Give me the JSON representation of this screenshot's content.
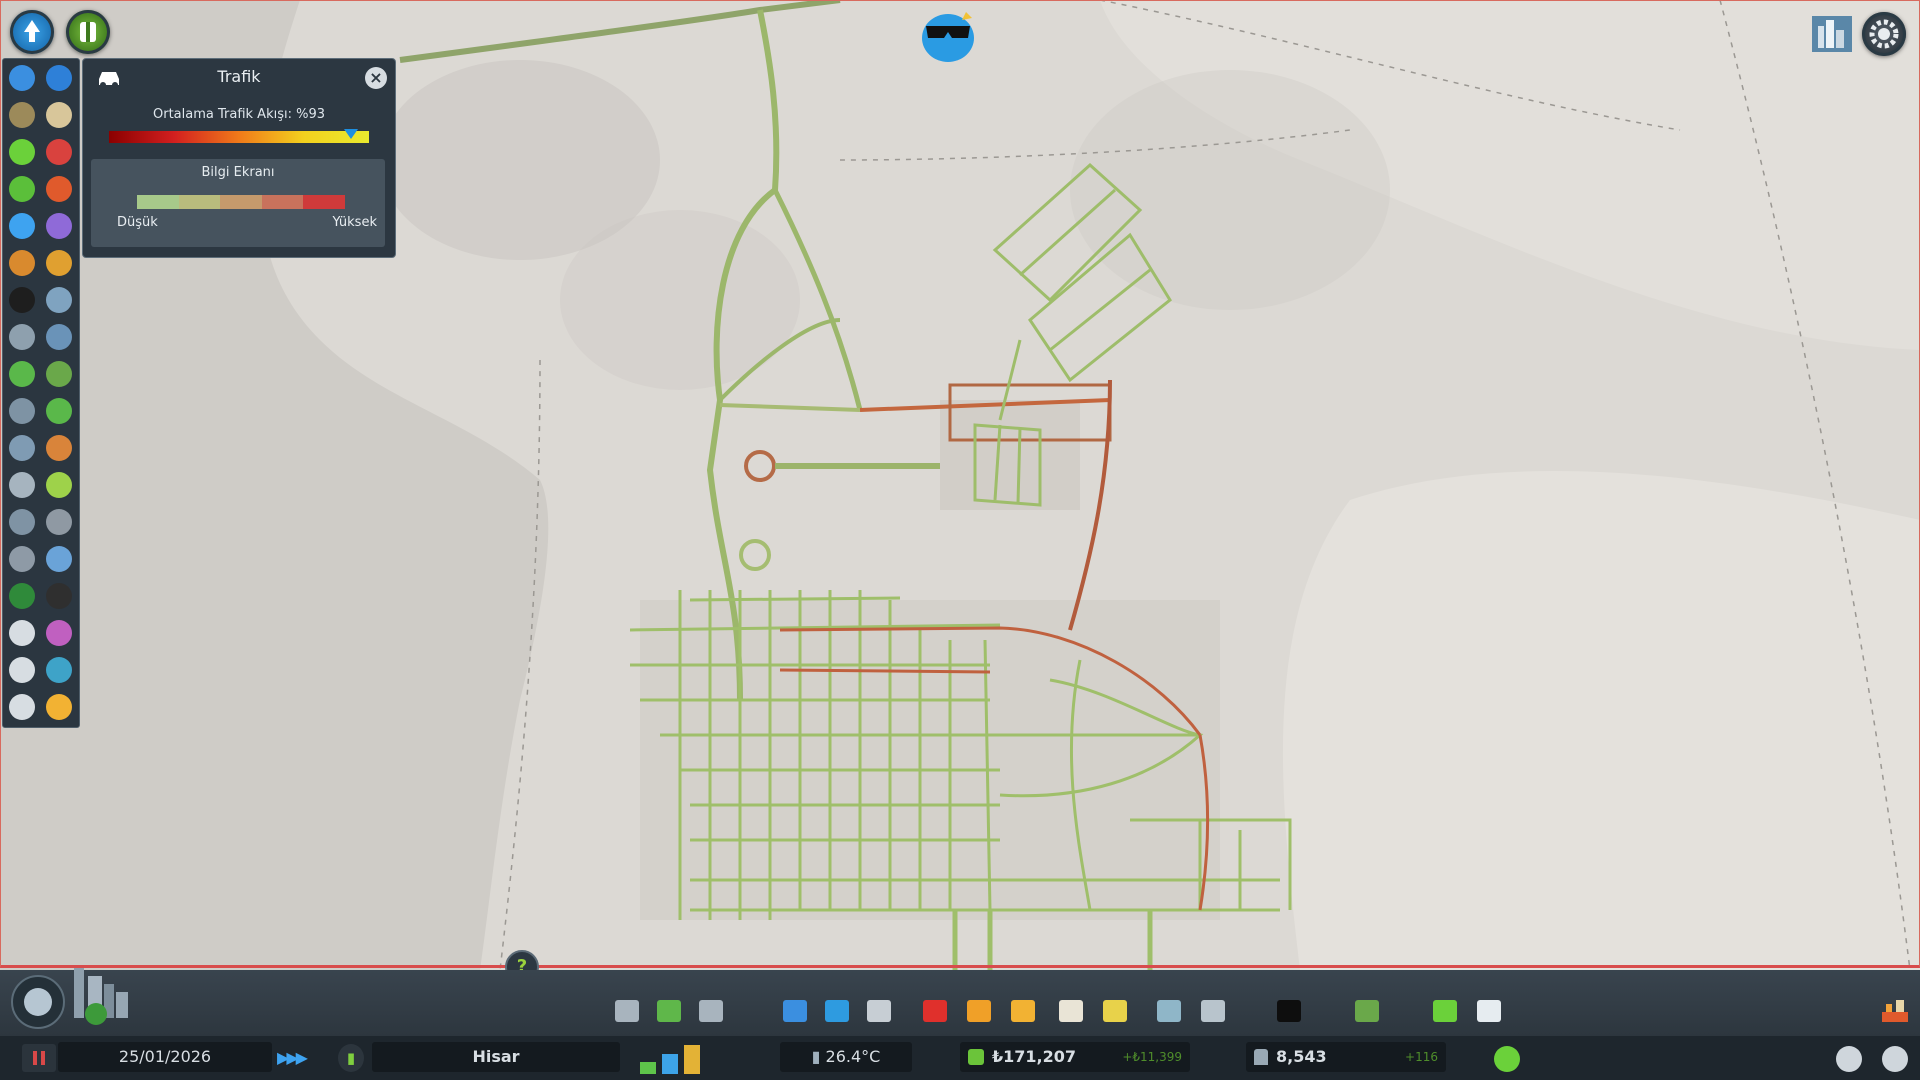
{
  "top": {
    "unlock_icon": "milestone-unlock-icon",
    "advisor_icon": "advisor-icon",
    "chirper_icon": "chirper-bird-icon",
    "paradox_icon": "paradox-store-icon",
    "settings_icon": "gear-icon"
  },
  "traffic_panel": {
    "title": "Trafik",
    "avg_flow_label": "Ortalama Trafik Akışı: %93",
    "avg_flow_percent": 93,
    "legend_title": "Bilgi Ekranı",
    "low_label": "Düşük",
    "high_label": "Yüksek",
    "legend_colors": [
      "#a7c98a",
      "#b9bc7d",
      "#c59a6c",
      "#c8725c",
      "#cf3a3a"
    ],
    "gradient_colors": [
      "#8b0000",
      "#d21f1f",
      "#f07a1a",
      "#f3d11e",
      "#e9ea2e"
    ],
    "marker_color": "#1d8fe0"
  },
  "left_toolbar": {
    "items": [
      "electricity-icon",
      "water-icon",
      "garbage-icon",
      "land-value-icon",
      "happiness-icon",
      "health-icon",
      "attractiveness-icon",
      "fire-safety-icon",
      "traffic-icon",
      "pollution-icon",
      "noise-icon",
      "crime-icon",
      "education-icon",
      "public-transport-icon",
      "population-icon",
      "tourism-icon",
      "economy-icon",
      "natural-resources-icon",
      "wind-icon",
      "parks-icon",
      "heating-icon",
      "buildings-icon",
      "maintenance-icon",
      "road-icon",
      "disaster-icon",
      "shelter-icon",
      "radio-icon",
      "districts-icon",
      "destruction-icon",
      "routes-icon",
      "tools-icon",
      "industry-icon",
      "mail-icon",
      "fishing-icon",
      "walking-icon",
      "leisure-icon"
    ]
  },
  "bottom_bar": {
    "date": "25/01/2026",
    "city_name": "Hisar",
    "temperature": "26.4°C",
    "money": "₺171,207",
    "money_delta": "+₺11,399",
    "population": "8,543",
    "population_delta": "+116",
    "tools": [
      "roads-icon",
      "zoning-icon",
      "districts-icon",
      "electricity-icon",
      "water-icon",
      "garbage-icon",
      "healthcare-icon",
      "fire-icon",
      "police-icon",
      "education-icon",
      "public-transport-icon",
      "parks-icon",
      "monuments-icon",
      "landscaping-icon",
      "terrain-icon",
      "economy-icon",
      "policies-icon"
    ],
    "demand": {
      "residential": 0.35,
      "commercial": 0.6,
      "industrial": 0.85
    }
  }
}
